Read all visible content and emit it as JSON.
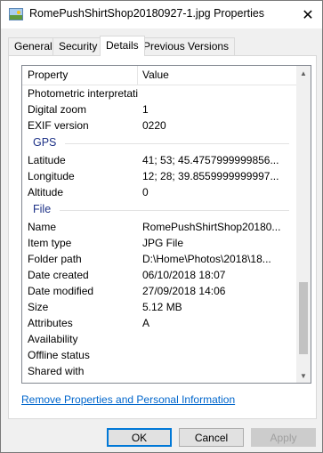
{
  "window": {
    "title": "RomePushShirtShop20180927-1.jpg Properties",
    "close_glyph": "✕"
  },
  "tabs": [
    {
      "label": "General"
    },
    {
      "label": "Security"
    },
    {
      "label": "Details",
      "active": true
    },
    {
      "label": "Previous Versions"
    }
  ],
  "list": {
    "header": {
      "property": "Property",
      "value": "Value"
    },
    "rows_top": [
      {
        "property": "Photometric interpretation",
        "value": ""
      },
      {
        "property": "Digital zoom",
        "value": "1"
      },
      {
        "property": "EXIF version",
        "value": "0220"
      }
    ],
    "group_gps": "GPS",
    "rows_gps": [
      {
        "property": "Latitude",
        "value": "41; 53; 45.4757999999856..."
      },
      {
        "property": "Longitude",
        "value": "12; 28; 39.8559999999997..."
      },
      {
        "property": "Altitude",
        "value": "0"
      }
    ],
    "group_file": "File",
    "rows_file": [
      {
        "property": "Name",
        "value": "RomePushShirtShop20180..."
      },
      {
        "property": "Item type",
        "value": "JPG File"
      },
      {
        "property": "Folder path",
        "value": "D:\\Home\\Photos\\2018\\18..."
      },
      {
        "property": "Date created",
        "value": "06/10/2018 18:07"
      },
      {
        "property": "Date modified",
        "value": "27/09/2018 14:06"
      },
      {
        "property": "Size",
        "value": "5.12 MB"
      },
      {
        "property": "Attributes",
        "value": "A"
      },
      {
        "property": "Availability",
        "value": ""
      },
      {
        "property": "Offline status",
        "value": ""
      },
      {
        "property": "Shared with",
        "value": ""
      }
    ],
    "scroll_position": 0.68
  },
  "link_text": "Remove Properties and Personal Information",
  "buttons": {
    "ok": "OK",
    "cancel": "Cancel",
    "apply": "Apply"
  },
  "colors": {
    "group_header": "#1e3287",
    "link": "#0066cc",
    "accent": "#0078d7"
  }
}
